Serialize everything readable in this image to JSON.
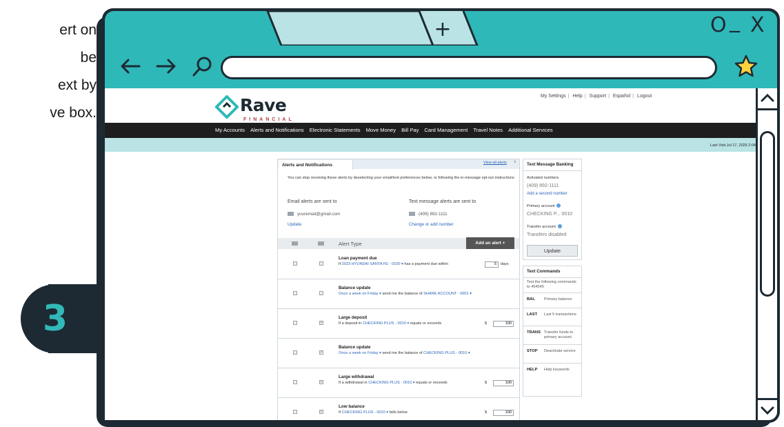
{
  "tutorial": {
    "lines": [
      "ert on",
      "be",
      "ext by",
      "ve box."
    ],
    "step_number": "3"
  },
  "browser": {
    "tab_new_symbol": "+",
    "window_controls": [
      "O",
      "_",
      "X"
    ],
    "icons": [
      "back-arrow-icon",
      "forward-arrow-icon",
      "search-icon",
      "star-icon",
      "chevron-up-icon",
      "chevron-down-icon"
    ],
    "colors": {
      "frame": "#1d2a33",
      "chrome": "#2fb8b8",
      "active_tab": "#b9e3e4"
    }
  },
  "bank": {
    "logo": {
      "name": "Rave",
      "sub": "FINANCIAL"
    },
    "top_links": [
      "My Settings",
      "Help",
      "Support",
      "Español",
      "Logout"
    ],
    "nav": [
      "My Accounts",
      "Alerts and Notifications",
      "Electronic Statements",
      "Move Money",
      "Bill Pay",
      "Card Management",
      "Travel Notes",
      "Additional Services"
    ],
    "last_visit": "Last Visit Jul 17, 2025 2:04"
  },
  "alerts": {
    "tab_label": "Alerts and Notifications",
    "view_all": "View all alerts",
    "help": "?",
    "intro": "You can stop receiving these alerts by deselecting your email/text preferences below, or following the in-message opt-out instructions",
    "email_label": "Email alerts are sent to",
    "email_value": "youremail@gmail.com",
    "email_link": "Update",
    "text_label": "Text message alerts are sent to",
    "text_value": "(409) 892-1111",
    "text_link": "Change or add number",
    "alert_type_header": "Alert Type",
    "add_button": "Add an alert +",
    "rows": [
      {
        "title": "Loan payment due",
        "pre": "If ",
        "link": "2023 HYUNDAI SANTA FE - 0100 ▾",
        "post": " has a payment due within",
        "input": "5",
        "unit": "days",
        "email_checked": false,
        "text_checked": false
      },
      {
        "title": "Balance update",
        "pre": "",
        "link": "Once a week on Friday ▾",
        "post": " send me the balance of ",
        "link2": "SHARE ACCOUNT - 0001 ▾",
        "email_checked": false,
        "text_checked": false
      },
      {
        "title": "Large deposit",
        "pre": "If a deposit in ",
        "link": "CHECKING PLUS - 0010 ▾",
        "post": " equals or exceeds",
        "currency": "$",
        "input": "100",
        "email_checked": false,
        "text_checked": true
      },
      {
        "title": "Balance update",
        "pre": "",
        "link": "Once a week on Friday ▾",
        "post": " send me the balance of ",
        "link2": "CHECKING PLUS - 0010 ▾",
        "email_checked": false,
        "text_checked": true
      },
      {
        "title": "Large withdrawal",
        "pre": "If a withdrawal in ",
        "link": "CHECKING PLUS - 0010 ▾",
        "post": " equals or exceeds",
        "currency": "$",
        "input": "100",
        "email_checked": false,
        "text_checked": true
      },
      {
        "title": "Low balance",
        "pre": "If ",
        "link": "CHECKING PLUS - 0010 ▾",
        "post": " falls below",
        "currency": "$",
        "input": "100",
        "email_checked": false,
        "text_checked": true
      }
    ]
  },
  "text_banking": {
    "title": "Text Message Banking",
    "activated_label": "Activated numbers",
    "activated_value": "(409) 892-1111",
    "add_link": "Add a second number",
    "primary_label": "Primary account",
    "primary_value": "CHECKING P... 0010",
    "transfer_label": "Transfer account",
    "transfer_value": "Transfers disabled",
    "update_button": "Update"
  },
  "text_commands": {
    "title": "Text Commands",
    "intro": "Text the following commands to 454545",
    "commands": [
      {
        "cmd": "BAL",
        "desc": "Primary balance"
      },
      {
        "cmd": "LAST",
        "desc": "Last 5 transactions"
      },
      {
        "cmd": "TRANS",
        "desc": "Transfer funds to primary account"
      },
      {
        "cmd": "STOP",
        "desc": "Deactivate service"
      },
      {
        "cmd": "HELP",
        "desc": "Help keywords"
      }
    ]
  }
}
